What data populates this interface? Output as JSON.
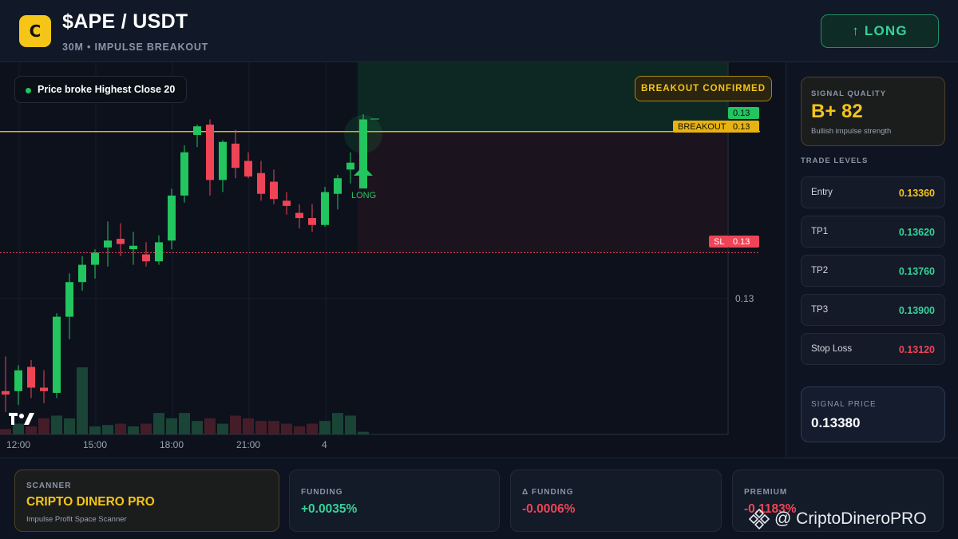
{
  "header": {
    "logo_letter": "C",
    "pair": "$APE / USDT",
    "subtitle": "30M • IMPULSE BREAKOUT",
    "long_button": "↑ LONG"
  },
  "chart": {
    "chip_text": "Price broke Highest Close 20",
    "confirm_badge": "BREAKOUT CONFIRMED",
    "breakout_label": "BREAKOUT",
    "price_tag_top": "0.13",
    "price_tag_breakout": "0.13",
    "sl_label": "SL",
    "sl_value": "0.13",
    "axis_price": "0.13",
    "long_marker": "LONG",
    "tv_logo": "TV",
    "time_labels": [
      "12:00",
      "15:00",
      "18:00",
      "21:00",
      "4"
    ],
    "colors": {
      "up": "#22c55e",
      "down": "#ef4456",
      "breakout": "#e8b310"
    }
  },
  "chart_data": {
    "type": "candlestick",
    "title": "",
    "x": [
      "c1",
      "c2",
      "c3",
      "c4",
      "c5",
      "c6",
      "c7",
      "c8",
      "c9",
      "c10",
      "c11",
      "c12",
      "c13",
      "c14",
      "c15",
      "c16",
      "c17",
      "c18",
      "c19",
      "c20",
      "c21",
      "c22",
      "c23",
      "c24",
      "c25",
      "c26",
      "c27",
      "c28"
    ],
    "ohlc": [
      [
        0.1328,
        0.133,
        0.13268,
        0.13278
      ],
      [
        0.1328,
        0.13295,
        0.13272,
        0.13292
      ],
      [
        0.13294,
        0.13298,
        0.13276,
        0.13282
      ],
      [
        0.13282,
        0.13292,
        0.13273,
        0.1328
      ],
      [
        0.13279,
        0.13325,
        0.13276,
        0.13323
      ],
      [
        0.13323,
        0.13348,
        0.1331,
        0.13343
      ],
      [
        0.13343,
        0.13358,
        0.13338,
        0.13353
      ],
      [
        0.13353,
        0.13362,
        0.13345,
        0.1336
      ],
      [
        0.13363,
        0.13378,
        0.13352,
        0.13367
      ],
      [
        0.13368,
        0.13377,
        0.13358,
        0.13365
      ],
      [
        0.13362,
        0.13372,
        0.13353,
        0.13364
      ],
      [
        0.13359,
        0.13366,
        0.13352,
        0.13355
      ],
      [
        0.13355,
        0.1337,
        0.13353,
        0.13366
      ],
      [
        0.13367,
        0.13397,
        0.13362,
        0.13393
      ],
      [
        0.13393,
        0.13422,
        0.13389,
        0.13418
      ],
      [
        0.13428,
        0.13434,
        0.13421,
        0.13433
      ],
      [
        0.13434,
        0.13437,
        0.13393,
        0.13402
      ],
      [
        0.13402,
        0.13425,
        0.13395,
        0.13424
      ],
      [
        0.13423,
        0.13431,
        0.13403,
        0.13409
      ],
      [
        0.13413,
        0.13418,
        0.13403,
        0.13404
      ],
      [
        0.13406,
        0.13413,
        0.1339,
        0.13394
      ],
      [
        0.13401,
        0.13408,
        0.13388,
        0.13391
      ],
      [
        0.1339,
        0.13395,
        0.13382,
        0.13387
      ],
      [
        0.13383,
        0.13388,
        0.13374,
        0.1338
      ],
      [
        0.1338,
        0.13388,
        0.13372,
        0.13376
      ],
      [
        0.13376,
        0.13398,
        0.13375,
        0.13395
      ],
      [
        0.13394,
        0.13405,
        0.13385,
        0.13403
      ],
      [
        0.13408,
        0.13418,
        0.134,
        0.13412
      ]
    ],
    "breakout_candle": [
      0.13405,
      0.1344,
      0.13408,
      0.13437
    ],
    "volume": [
      0.2,
      0.4,
      0.3,
      0.6,
      0.7,
      0.6,
      2.5,
      0.3,
      0.35,
      0.4,
      0.3,
      0.4,
      0.8,
      0.6,
      0.8,
      0.5,
      0.6,
      0.4,
      0.7,
      0.6,
      0.5,
      0.5,
      0.4,
      0.3,
      0.4,
      0.5,
      0.8,
      0.7,
      0.1
    ],
    "levels": {
      "breakout": 0.1343,
      "stop_loss": 0.1336,
      "entry": 0.1336
    },
    "ylim": [
      0.13255,
      0.1347
    ],
    "xlabel": "",
    "ylabel": ""
  },
  "side": {
    "quality_caption": "SIGNAL QUALITY",
    "quality_value": "B+ 82",
    "quality_desc": "Bullish impulse strength",
    "levels_caption": "TRADE LEVELS",
    "levels": [
      {
        "name": "Entry",
        "value": "0.13360",
        "color": "#f5c518"
      },
      {
        "name": "TP1",
        "value": "0.13620",
        "color": "#34d399"
      },
      {
        "name": "TP2",
        "value": "0.13760",
        "color": "#34d399"
      },
      {
        "name": "TP3",
        "value": "0.13900",
        "color": "#34d399"
      },
      {
        "name": "Stop Loss",
        "value": "0.13120",
        "color": "#ef4456"
      }
    ],
    "signal_price_caption": "SIGNAL PRICE",
    "signal_price_value": "0.13380"
  },
  "footer": {
    "scanner_caption": "SCANNER",
    "scanner_value": "CRIPTO DINERO PRO",
    "scanner_sub": "Impulse Profit Space Scanner",
    "funding_caption": "FUNDING",
    "funding_value": "+0.0035%",
    "dfunding_caption": "Δ FUNDING",
    "dfunding_value": "-0.0006%",
    "premium_caption": "PREMIUM",
    "premium_value": "-0.1183%",
    "watermark": "@ CriptoDineroPRO"
  }
}
